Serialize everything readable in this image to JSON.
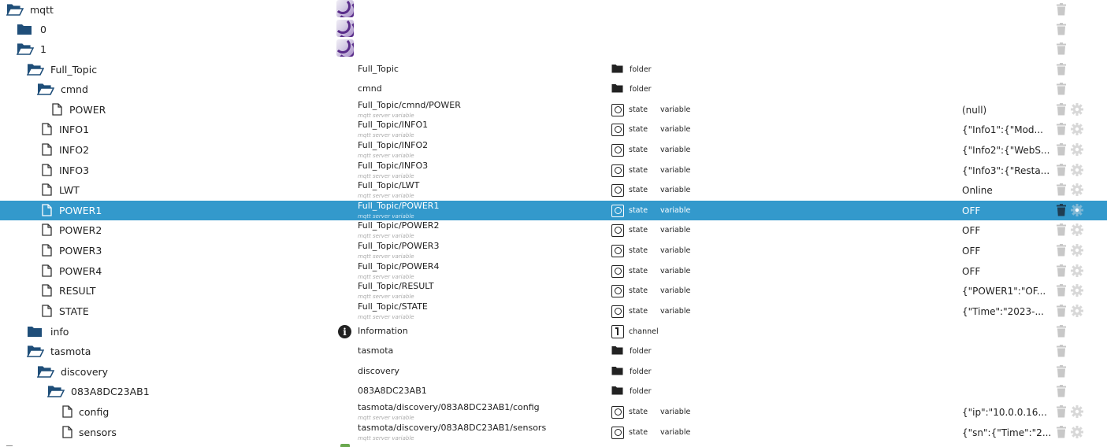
{
  "colors": {
    "selected_row_bg": "#3399cc",
    "folder_icon": "#1f4e79",
    "type_icon": "#222222",
    "action_icon": "#c8c8c8"
  },
  "icons": {
    "folder_open": "folder-open-icon",
    "folder_closed": "folder-icon",
    "file": "file-icon",
    "state": "state-icon",
    "channel": "channel-icon",
    "info": "info-icon",
    "trash": "trash-icon",
    "gear": "gear-icon",
    "mqtt_adapter": "mqtt-adapter-icon"
  },
  "rows": [
    {
      "name": "mqtt",
      "icon": "folder-open",
      "indent": 0,
      "adapter_icon": true,
      "desc": "",
      "sub": "",
      "type": "",
      "role": "",
      "value": "",
      "gear": false
    },
    {
      "name": "0",
      "icon": "folder",
      "indent": 1,
      "adapter_icon": true,
      "desc": "",
      "sub": "",
      "type": "",
      "role": "",
      "value": "",
      "gear": false
    },
    {
      "name": "1",
      "icon": "folder-open",
      "indent": 1,
      "adapter_icon": true,
      "desc": "",
      "sub": "",
      "type": "",
      "role": "",
      "value": "",
      "gear": false
    },
    {
      "name": "Full_Topic",
      "icon": "folder-open",
      "indent": 2,
      "desc": "Full_Topic",
      "sub": "",
      "type": "folder",
      "role": "",
      "value": "",
      "gear": false
    },
    {
      "name": "cmnd",
      "icon": "folder-open",
      "indent": 3,
      "desc": "cmnd",
      "sub": "",
      "type": "folder",
      "role": "",
      "value": "",
      "gear": false
    },
    {
      "name": "POWER",
      "icon": "file",
      "indent": 4,
      "desc": "Full_Topic/cmnd/POWER",
      "sub": "mqtt server variable",
      "type": "state",
      "role": "variable",
      "value": "(null)",
      "gear": true
    },
    {
      "name": "INFO1",
      "icon": "file",
      "indent": 3,
      "desc": "Full_Topic/INFO1",
      "sub": "mqtt server variable",
      "type": "state",
      "role": "variable",
      "value": "{\"Info1\":{\"Mod...",
      "gear": true
    },
    {
      "name": "INFO2",
      "icon": "file",
      "indent": 3,
      "desc": "Full_Topic/INFO2",
      "sub": "mqtt server variable",
      "type": "state",
      "role": "variable",
      "value": "{\"Info2\":{\"WebS...",
      "gear": true
    },
    {
      "name": "INFO3",
      "icon": "file",
      "indent": 3,
      "desc": "Full_Topic/INFO3",
      "sub": "mqtt server variable",
      "type": "state",
      "role": "variable",
      "value": "{\"Info3\":{\"Resta...",
      "gear": true
    },
    {
      "name": "LWT",
      "icon": "file",
      "indent": 3,
      "desc": "Full_Topic/LWT",
      "sub": "mqtt server variable",
      "type": "state",
      "role": "variable",
      "value": "Online",
      "gear": true
    },
    {
      "name": "POWER1",
      "icon": "file",
      "indent": 3,
      "desc": "Full_Topic/POWER1",
      "sub": "mqtt server variable",
      "type": "state",
      "role": "variable",
      "value": "OFF",
      "gear": true,
      "selected": true
    },
    {
      "name": "POWER2",
      "icon": "file",
      "indent": 3,
      "desc": "Full_Topic/POWER2",
      "sub": "mqtt server variable",
      "type": "state",
      "role": "variable",
      "value": "OFF",
      "gear": true
    },
    {
      "name": "POWER3",
      "icon": "file",
      "indent": 3,
      "desc": "Full_Topic/POWER3",
      "sub": "mqtt server variable",
      "type": "state",
      "role": "variable",
      "value": "OFF",
      "gear": true
    },
    {
      "name": "POWER4",
      "icon": "file",
      "indent": 3,
      "desc": "Full_Topic/POWER4",
      "sub": "mqtt server variable",
      "type": "state",
      "role": "variable",
      "value": "OFF",
      "gear": true
    },
    {
      "name": "RESULT",
      "icon": "file",
      "indent": 3,
      "desc": "Full_Topic/RESULT",
      "sub": "mqtt server variable",
      "type": "state",
      "role": "variable",
      "value": "{\"POWER1\":\"OF...",
      "gear": true
    },
    {
      "name": "STATE",
      "icon": "file",
      "indent": 3,
      "desc": "Full_Topic/STATE",
      "sub": "mqtt server variable",
      "type": "state",
      "role": "variable",
      "value": "{\"Time\":\"2023-...",
      "gear": true
    },
    {
      "name": "info",
      "icon": "folder",
      "indent": 2,
      "info_icon": true,
      "desc": "Information",
      "sub": "",
      "type": "channel",
      "role": "",
      "value": "",
      "gear": false
    },
    {
      "name": "tasmota",
      "icon": "folder-open",
      "indent": 2,
      "desc": "tasmota",
      "sub": "",
      "type": "folder",
      "role": "",
      "value": "",
      "gear": false
    },
    {
      "name": "discovery",
      "icon": "folder-open",
      "indent": 3,
      "desc": "discovery",
      "sub": "",
      "type": "folder",
      "role": "",
      "value": "",
      "gear": false
    },
    {
      "name": "083A8DC23AB1",
      "icon": "folder-open",
      "indent": 4,
      "desc": "083A8DC23AB1",
      "sub": "",
      "type": "folder",
      "role": "",
      "value": "",
      "gear": false
    },
    {
      "name": "config",
      "icon": "file",
      "indent": 5,
      "desc": "tasmota/discovery/083A8DC23AB1/config",
      "sub": "mqtt server variable",
      "type": "state",
      "role": "variable",
      "value": "{\"ip\":\"10.0.0.16...",
      "gear": true
    },
    {
      "name": "sensors",
      "icon": "file",
      "indent": 5,
      "desc": "tasmota/discovery/083A8DC23AB1/sensors",
      "sub": "mqtt server variable",
      "type": "state",
      "role": "variable",
      "value": "{\"sn\":{\"Time\":\"2...",
      "gear": true
    }
  ]
}
